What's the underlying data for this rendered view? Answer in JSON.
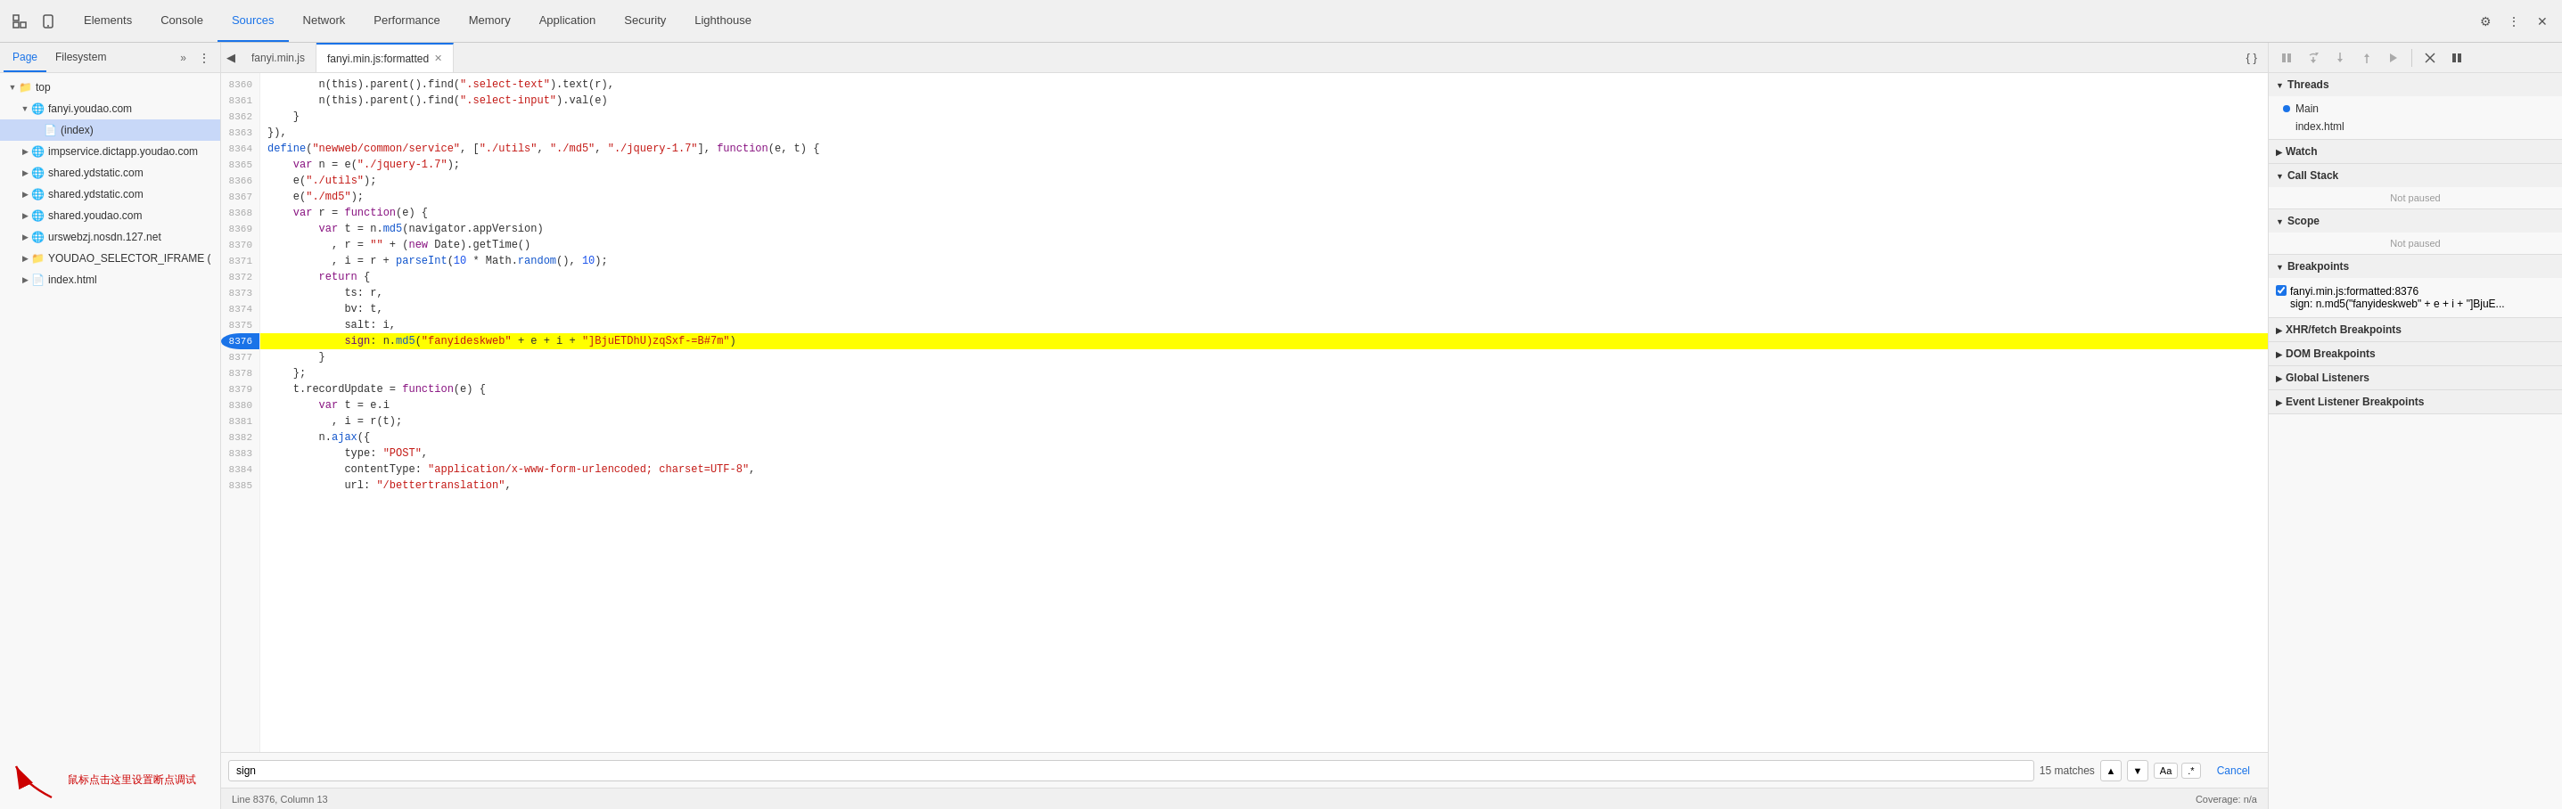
{
  "topbar": {
    "tabs": [
      {
        "id": "elements",
        "label": "Elements",
        "active": false
      },
      {
        "id": "console",
        "label": "Console",
        "active": false
      },
      {
        "id": "sources",
        "label": "Sources",
        "active": true
      },
      {
        "id": "network",
        "label": "Network",
        "active": false
      },
      {
        "id": "performance",
        "label": "Performance",
        "active": false
      },
      {
        "id": "memory",
        "label": "Memory",
        "active": false
      },
      {
        "id": "application",
        "label": "Application",
        "active": false
      },
      {
        "id": "security",
        "label": "Security",
        "active": false
      },
      {
        "id": "lighthouse",
        "label": "Lighthouse",
        "active": false
      }
    ]
  },
  "sidebar": {
    "tabs": [
      "Page",
      "Filesystem"
    ],
    "activeTab": "Page",
    "tree": [
      {
        "id": "top",
        "label": "top",
        "indent": 0,
        "arrow": "down",
        "icon": "folder"
      },
      {
        "id": "fanyi-youdao",
        "label": "fanyi.youdao.com",
        "indent": 1,
        "arrow": "down",
        "icon": "domain"
      },
      {
        "id": "index",
        "label": "(index)",
        "indent": 2,
        "arrow": null,
        "icon": "file",
        "selected": true
      },
      {
        "id": "impservice",
        "label": "impservice.dictapp.youdao.com",
        "indent": 1,
        "arrow": "right",
        "icon": "domain"
      },
      {
        "id": "shared1",
        "label": "shared.ydstatic.com",
        "indent": 1,
        "arrow": "right",
        "icon": "domain"
      },
      {
        "id": "shared2",
        "label": "shared.ydstatic.com",
        "indent": 1,
        "arrow": "right",
        "icon": "domain"
      },
      {
        "id": "shared-youdao",
        "label": "shared.youdao.com",
        "indent": 1,
        "arrow": "right",
        "icon": "domain"
      },
      {
        "id": "urswebzj",
        "label": "urswebzj.nosdn.127.net",
        "indent": 1,
        "arrow": "right",
        "icon": "domain"
      },
      {
        "id": "youdao-selector",
        "label": "YOUDAO_SELECTOR_IFRAME (",
        "indent": 1,
        "arrow": "right",
        "icon": "folder"
      },
      {
        "id": "index-html",
        "label": "index.html",
        "indent": 1,
        "arrow": "right",
        "icon": "file"
      }
    ]
  },
  "editor": {
    "tabs": [
      {
        "label": "fanyi.min.js",
        "active": false,
        "closeable": false
      },
      {
        "label": "fanyi.min.js:formatted",
        "active": true,
        "closeable": true
      }
    ],
    "lines": [
      {
        "num": 8360,
        "code": "        n(this).parent().find(\".select-text\").text(r),",
        "highlight": false
      },
      {
        "num": 8361,
        "code": "        n(this).parent().find(\".select-input\").val(e)",
        "highlight": false
      },
      {
        "num": 8362,
        "code": "    }",
        "highlight": false
      },
      {
        "num": 8363,
        "code": "}),",
        "highlight": false
      },
      {
        "num": 8364,
        "code": "define(\"newweb/common/service\", [\"./utils\", \"./md5\", \"./jquery-1.7\"], function(e, t) {",
        "highlight": false
      },
      {
        "num": 8365,
        "code": "    var n = e(\"./jquery-1.7\");",
        "highlight": false
      },
      {
        "num": 8366,
        "code": "    e(\"./utils\");",
        "highlight": false
      },
      {
        "num": 8367,
        "code": "    e(\"./md5\");",
        "highlight": false
      },
      {
        "num": 8368,
        "code": "    var r = function(e) {",
        "highlight": false
      },
      {
        "num": 8369,
        "code": "        var t = n.md5(navigator.appVersion)",
        "highlight": false
      },
      {
        "num": 8370,
        "code": "          , r = \"\" + (new Date).getTime()",
        "highlight": false
      },
      {
        "num": 8371,
        "code": "          , i = r + parseInt(10 * Math.random(), 10);",
        "highlight": false
      },
      {
        "num": 8372,
        "code": "        return {",
        "highlight": false
      },
      {
        "num": 8373,
        "code": "            ts: r,",
        "highlight": false
      },
      {
        "num": 8374,
        "code": "            bv: t,",
        "highlight": false
      },
      {
        "num": 8375,
        "code": "            salt: i,",
        "highlight": false
      },
      {
        "num": 8376,
        "code": "            sign: n.md5(\"fanyideskweb\" + e + i + \"]BjuETDhU)zqSxf-=B#7m\")",
        "highlight": true,
        "breakpoint": true
      },
      {
        "num": 8377,
        "code": "        }",
        "highlight": false
      },
      {
        "num": 8378,
        "code": "    };",
        "highlight": false
      },
      {
        "num": 8379,
        "code": "    t.recordUpdate = function(e) {",
        "highlight": false
      },
      {
        "num": 8380,
        "code": "        var t = e.i",
        "highlight": false
      },
      {
        "num": 8381,
        "code": "          , i = r(t);",
        "highlight": false
      },
      {
        "num": 8382,
        "code": "        n.ajax({",
        "highlight": false
      },
      {
        "num": 8383,
        "code": "            type: \"POST\",",
        "highlight": false
      },
      {
        "num": 8384,
        "code": "            contentType: \"application/x-www-form-urlencoded; charset=UTF-8\",",
        "highlight": false
      },
      {
        "num": 8385,
        "code": "            url: \"/bettertranslation\",",
        "highlight": false
      }
    ],
    "searchQuery": "sign",
    "searchMatches": "15 matches",
    "statusLine": "Line 8376, Column 13",
    "statusRight": "Coverage: n/a"
  },
  "rightPanel": {
    "debugButtons": [
      {
        "id": "pause",
        "icon": "⏸",
        "label": "Pause"
      },
      {
        "id": "step-over",
        "icon": "↷",
        "label": "Step over"
      },
      {
        "id": "step-into",
        "icon": "↓",
        "label": "Step into"
      },
      {
        "id": "step-out",
        "icon": "↑",
        "label": "Step out"
      },
      {
        "id": "step",
        "icon": "→",
        "label": "Step"
      },
      {
        "id": "deactivate",
        "icon": "✏",
        "label": "Deactivate"
      },
      {
        "id": "pause-exceptions",
        "icon": "⏸",
        "label": "Pause on exceptions"
      }
    ],
    "sections": {
      "threads": {
        "title": "Threads",
        "items": [
          {
            "label": "Main",
            "active": true
          },
          {
            "label": "index.html"
          }
        ]
      },
      "watch": {
        "title": "Watch",
        "collapsed": false
      },
      "callStack": {
        "title": "Call Stack",
        "content": "Not paused"
      },
      "scope": {
        "title": "Scope",
        "content": "Not paused"
      },
      "breakpoints": {
        "title": "Breakpoints",
        "items": [
          {
            "file": "fanyi.min.js:formatted:8376",
            "code": "sign: n.md5(\"fanyideskweb\" + e + i + \"]BjuE..."
          }
        ]
      },
      "xhrBreakpoints": {
        "title": "XHR/fetch Breakpoints"
      },
      "domBreakpoints": {
        "title": "DOM Breakpoints"
      },
      "globalListeners": {
        "title": "Global Listeners"
      },
      "eventListenerBreakpoints": {
        "title": "Event Listener Breakpoints"
      }
    }
  },
  "annotation": {
    "text": "鼠标点击这里设置断点调试",
    "arrowSymbol": "→"
  }
}
